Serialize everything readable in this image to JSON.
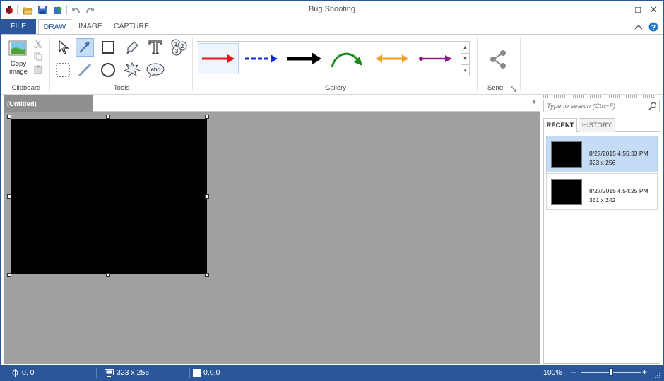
{
  "window": {
    "title": "Bug Shooting",
    "minimize_glyph": "–",
    "maximize_glyph": "☐",
    "close_glyph": "✕"
  },
  "ribbon_tabs": [
    {
      "label": "FILE"
    },
    {
      "label": "DRAW"
    },
    {
      "label": "IMAGE"
    },
    {
      "label": "CAPTURE"
    }
  ],
  "groups": {
    "clipboard": {
      "label": "Clipboard",
      "copy_image_label": "Copy\nimage"
    },
    "tools": {
      "label": "Tools"
    },
    "gallery": {
      "label": "Gallery",
      "arrows": [
        {
          "icon": "red-arrow-icon",
          "color": "#e8141a"
        },
        {
          "icon": "blue-dashed-arrow-icon",
          "color": "#1028d8"
        },
        {
          "icon": "black-arrow-icon",
          "color": "#000000"
        },
        {
          "icon": "green-curved-arrow-icon",
          "color": "#1a8a1a"
        },
        {
          "icon": "orange-double-arrow-icon",
          "color": "#f2a31a"
        },
        {
          "icon": "purple-arrow-icon",
          "color": "#8a1a8a"
        }
      ]
    },
    "send": {
      "label": "Send"
    }
  },
  "document": {
    "tab_label": "(Untitled)"
  },
  "panel": {
    "search_placeholder": "Type to search (Ctrl+F)",
    "tabs": [
      {
        "label": "RECENT"
      },
      {
        "label": "HISTORY"
      }
    ],
    "items": [
      {
        "date": "8/27/2015 4:55:33 PM",
        "size": "323 x 256"
      },
      {
        "date": "8/27/2015 4:54:25 PM",
        "size": "351 x 242"
      }
    ]
  },
  "status": {
    "position": "0, 0",
    "image_size": "323 x 256",
    "color_value": "0,0,0",
    "zoom": "100%",
    "zoom_minus": "–",
    "zoom_plus": "+",
    "zoom_level": 0.5
  },
  "colors": {
    "accent": "#2b579a",
    "canvas_bg": "#a0a0a0",
    "selected_item": "#c5dcf6"
  }
}
